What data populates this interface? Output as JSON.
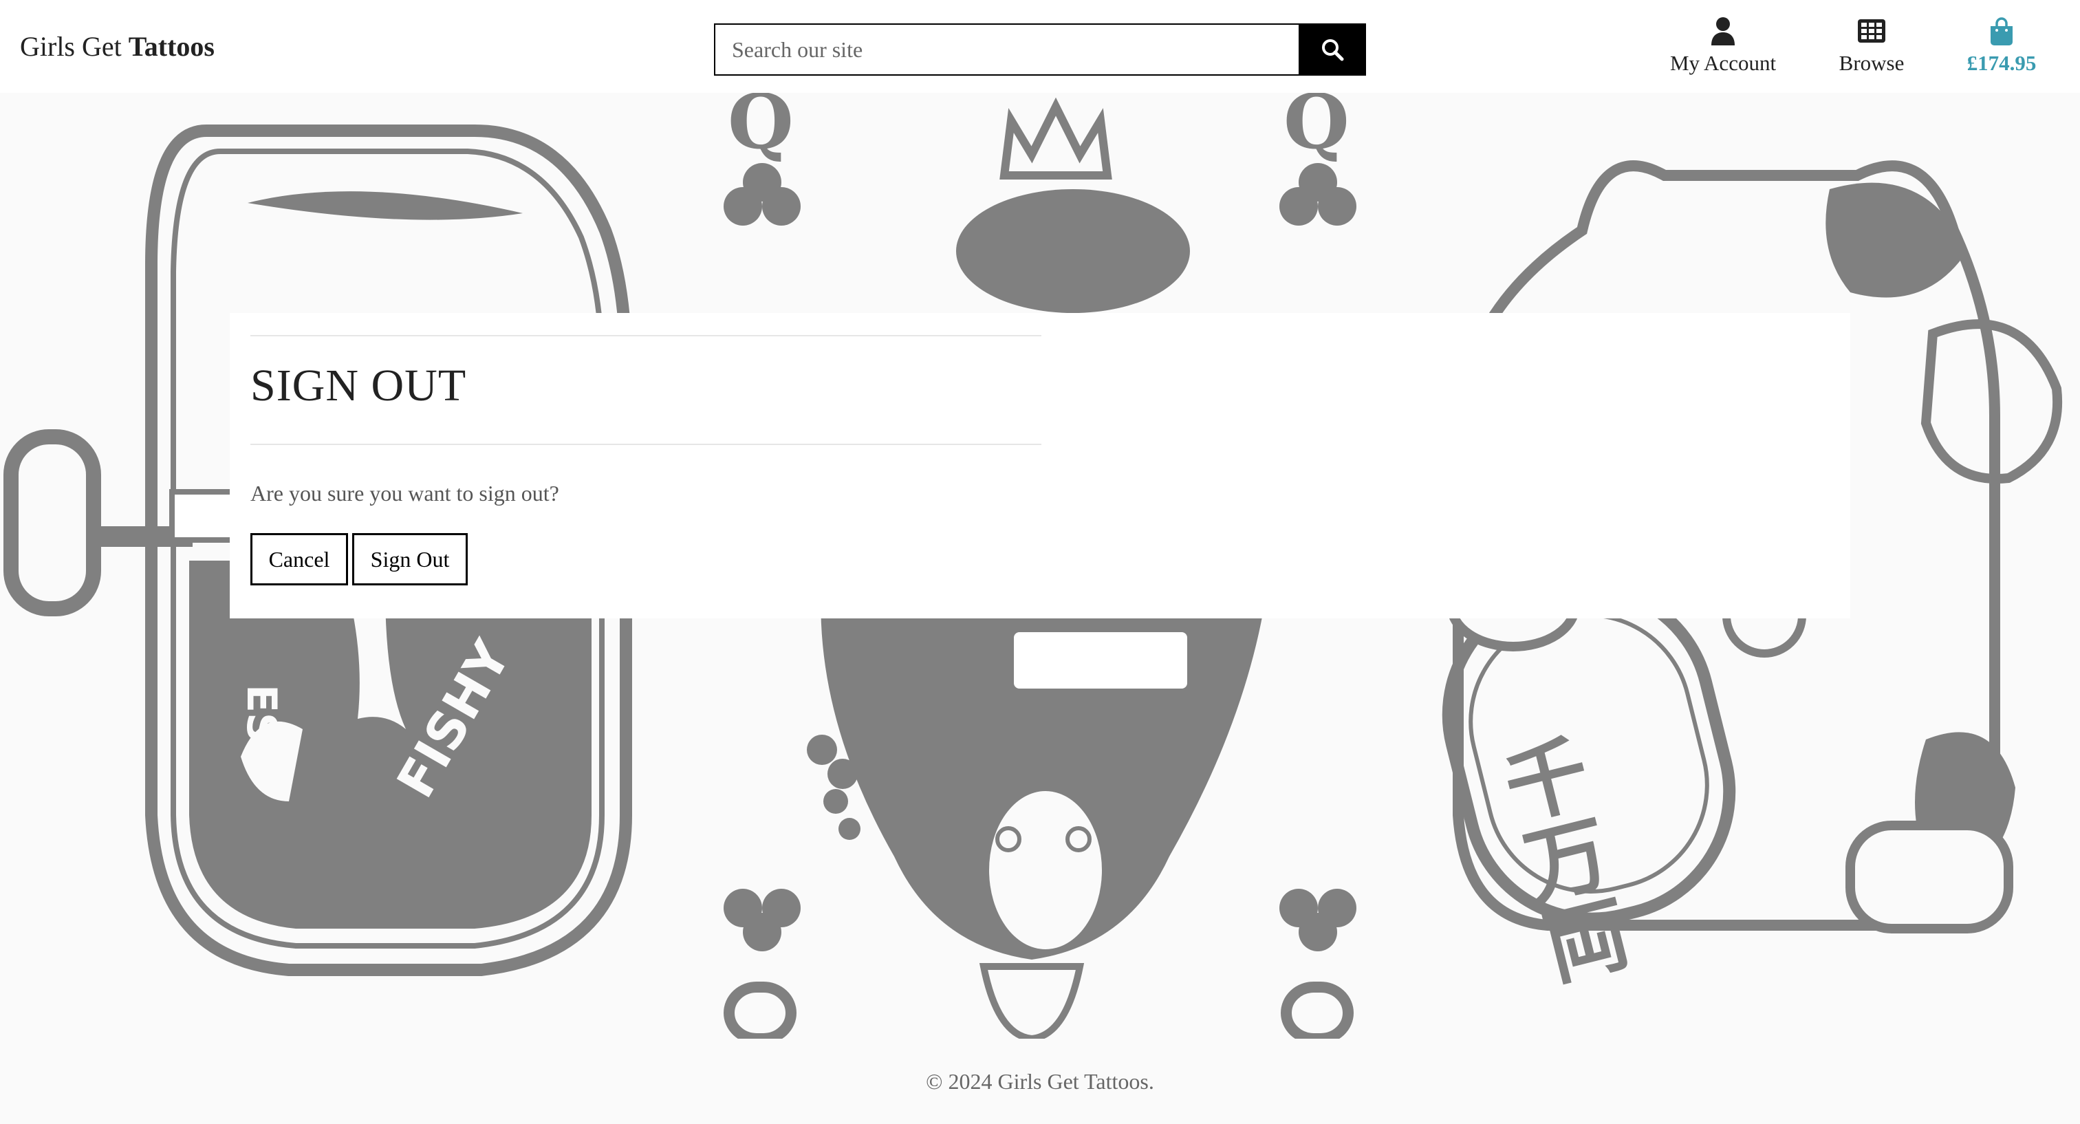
{
  "header": {
    "logo_prefix": "Girls Get ",
    "logo_bold": "Tattoos",
    "search": {
      "placeholder": "Search our site",
      "value": "",
      "button_icon": "search-icon"
    },
    "nav": {
      "account_label": "My Account",
      "account_icon": "user-icon",
      "browse_label": "Browse",
      "browse_icon": "grid-icon",
      "cart_total": "£174.95",
      "cart_icon": "shopping-bag-icon"
    }
  },
  "hero": {
    "panels": [
      "sardine-can-illustration",
      "queen-playing-card-illustration",
      "lucky-cat-illustration"
    ],
    "can_text": [
      "ES",
      "FISHY"
    ],
    "cat_coin_text": "千万両"
  },
  "signout": {
    "title": "SIGN OUT",
    "message": "Are you sure you want to sign out?",
    "cancel_label": "Cancel",
    "signout_label": "Sign Out"
  },
  "footer": {
    "copyright": "© 2024 Girls Get Tattoos."
  },
  "colors": {
    "accent": "#3a9bb0",
    "illustration": "#808080",
    "background": "#fafafa"
  }
}
